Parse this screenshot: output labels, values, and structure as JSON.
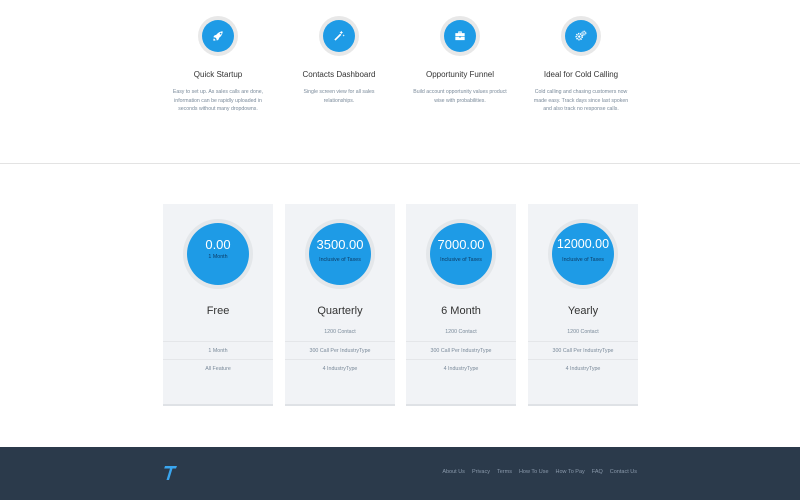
{
  "features": [
    {
      "icon": "rocket-icon",
      "title": "Quick Startup",
      "desc": [
        "Easy to set up. As sales calls are done,",
        "information can be rapidly uploaded in",
        "seconds without many dropdowns."
      ]
    },
    {
      "icon": "magic-wand-icon",
      "title": "Contacts Dashboard",
      "desc": [
        "Single screen view for all sales",
        "relationships."
      ]
    },
    {
      "icon": "briefcase-icon",
      "title": "Opportunity Funnel",
      "desc": [
        "Build account opportunity values product",
        "wise with probabilities."
      ]
    },
    {
      "icon": "gears-icon",
      "title": "Ideal for Cold Calling",
      "desc": [
        "Cold calling and chasing customers now",
        "made easy. Track days since last spoken",
        "and also track no response calls."
      ]
    }
  ],
  "plans": [
    {
      "price": "0.00",
      "sub": "1 Month",
      "name": "Free",
      "rows": [
        "",
        "1 Month",
        "All Feature"
      ]
    },
    {
      "price": "3500.00",
      "sub": "Inclusive of Taxes",
      "name": "Quarterly",
      "rows": [
        "1200 Contact",
        "300 Call Per IndustryType",
        "4 IndustryType"
      ]
    },
    {
      "price": "7000.00",
      "sub": "Inclusive of Taxes",
      "name": "6 Month",
      "rows": [
        "1200 Contact",
        "300 Call Per IndustryType",
        "4 IndustryType"
      ]
    },
    {
      "price": "12000.00",
      "sub": "Inclusive of Taxes",
      "name": "Yearly",
      "rows": [
        "1200 Contact",
        "300 Call Per IndustryType",
        "4 IndustryType"
      ]
    }
  ],
  "footer": {
    "logo": "T",
    "links": [
      "About Us",
      "Privacy",
      "Terms",
      "How To Use",
      "How To Pay",
      "FAQ",
      "Contact Us"
    ]
  },
  "colors": {
    "accent": "#1e9be6",
    "footer_bg": "#2b3a4b",
    "card_bg": "#f1f3f6"
  }
}
